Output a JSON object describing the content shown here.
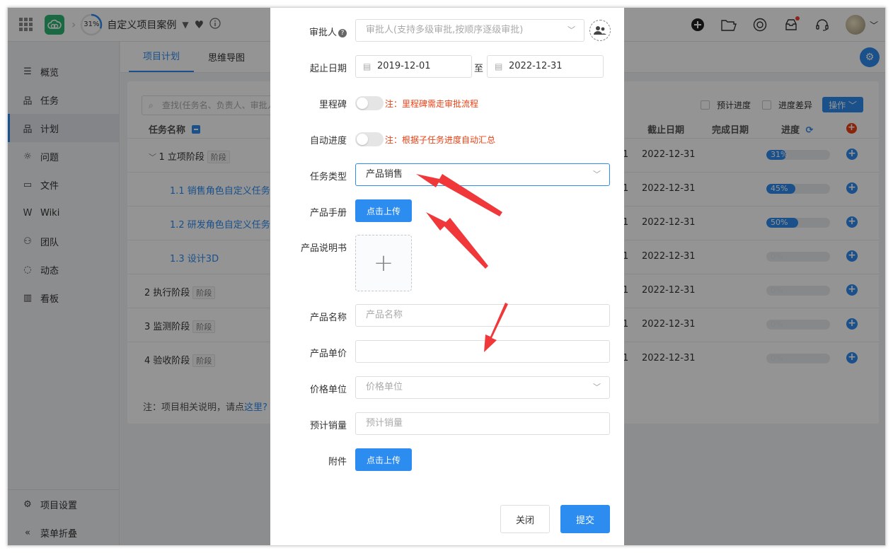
{
  "header": {
    "progress": "31%",
    "progress_value": 0.31,
    "project_title": "自定义项目案例"
  },
  "sidebar": {
    "items": [
      {
        "label": "概览",
        "icon": "overview-icon"
      },
      {
        "label": "任务",
        "icon": "task-icon"
      },
      {
        "label": "计划",
        "icon": "plan-icon"
      },
      {
        "label": "问题",
        "icon": "bug-icon"
      },
      {
        "label": "文件",
        "icon": "folder-icon"
      },
      {
        "label": "Wiki",
        "icon": "wiki-icon"
      },
      {
        "label": "团队",
        "icon": "team-icon"
      },
      {
        "label": "动态",
        "icon": "activity-icon"
      },
      {
        "label": "看板",
        "icon": "kanban-icon"
      }
    ],
    "settings": "项目设置",
    "collapse": "菜单折叠"
  },
  "tabs": [
    "项目计划",
    "思维导图"
  ],
  "toolbar": {
    "search_placeholder": "查找(任务名、负责人、审批人",
    "expected_progress": "预计进度",
    "progress_diff": "进度差异",
    "operate": "操作"
  },
  "table": {
    "headers": {
      "name": "任务名称",
      "deadline": "截止日期",
      "done_date": "完成日期",
      "progress": "进度"
    },
    "rows": [
      {
        "name": "1 立项阶段",
        "tag": "阶段",
        "frag": "1",
        "deadline": "2022-12-31",
        "progress": "31%",
        "value": 0.31,
        "link": false,
        "level": 0
      },
      {
        "name": "1.1 销售角色自定义任务",
        "tag": "",
        "frag": "1",
        "deadline": "2022-12-31",
        "progress": "45%",
        "value": 0.45,
        "link": true,
        "level": 1
      },
      {
        "name": "1.2 研发角色自定义任务",
        "tag": "",
        "frag": "1",
        "deadline": "2022-12-31",
        "progress": "50%",
        "value": 0.5,
        "link": true,
        "level": 1
      },
      {
        "name": "1.3 设计3D",
        "tag": "",
        "frag": "1",
        "deadline": "2022-12-31",
        "progress": "0%",
        "value": 0,
        "link": true,
        "level": 1
      },
      {
        "name": "2 执行阶段",
        "tag": "阶段",
        "frag": "1",
        "deadline": "2022-12-31",
        "progress": "0%",
        "value": 0,
        "link": false,
        "level": 0
      },
      {
        "name": "3 监测阶段",
        "tag": "阶段",
        "frag": "1",
        "deadline": "2022-12-31",
        "progress": "0%",
        "value": 0,
        "link": false,
        "level": 0
      },
      {
        "name": "4 验收阶段",
        "tag": "阶段",
        "frag": "1",
        "deadline": "2022-12-31",
        "progress": "0%",
        "value": 0,
        "link": false,
        "level": 0
      }
    ],
    "note_prefix": "注：项目相关说明，请点",
    "note_link": "这里?"
  },
  "modal": {
    "approver_label": "审批人",
    "approver_placeholder": "审批人(支持多级审批,按顺序逐级审批)",
    "date_label": "起止日期",
    "start_date": "2019-12-01",
    "date_sep": "至",
    "end_date": "2022-12-31",
    "milestone_label": "里程碑",
    "milestone_note": "注：里程碑需走审批流程",
    "auto_progress_label": "自动进度",
    "auto_progress_note": "注：根据子任务进度自动汇总",
    "task_type_label": "任务类型",
    "task_type_value": "产品销售",
    "manual_label": "产品手册",
    "upload_label": "点击上传",
    "spec_label": "产品说明书",
    "product_name_label": "产品名称",
    "product_name_placeholder": "产品名称",
    "unit_price_label": "产品单价",
    "unit_price_value": "",
    "price_unit_label": "价格单位",
    "price_unit_placeholder": "价格单位",
    "sales_label": "预计销量",
    "sales_placeholder": "预计销量",
    "attachment_label": "附件",
    "attachment_upload": "点击上传",
    "close": "关闭",
    "submit": "提交"
  },
  "colors": {
    "primary": "#2d8cf0",
    "danger": "#ed4014",
    "annotation_arrow": "#f0383a"
  }
}
